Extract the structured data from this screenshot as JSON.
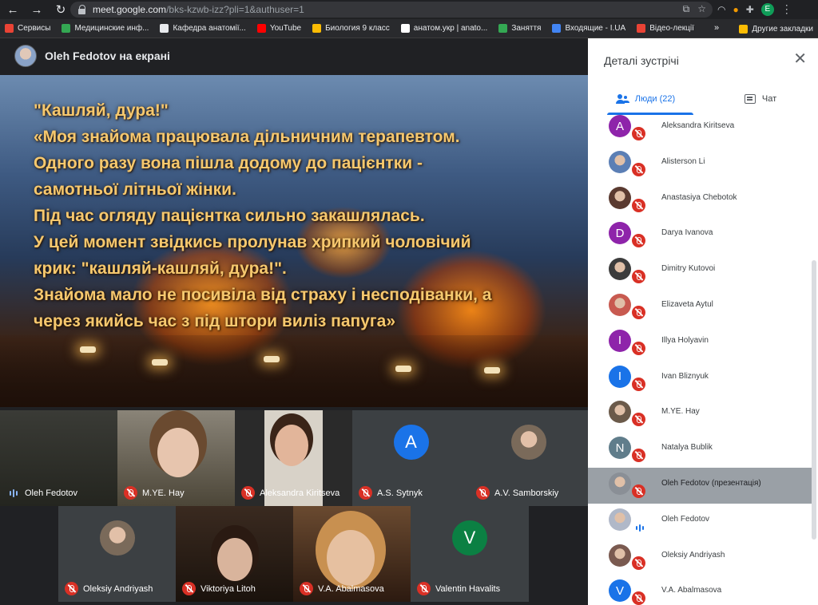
{
  "browser": {
    "url_host": "meet.google.com",
    "url_path": "/bks-kzwb-izz?pli=1&authuser=1",
    "profile_initial": "E",
    "bookmarks": [
      {
        "label": "Сервисы",
        "color": "#ea4335"
      },
      {
        "label": "Медицинские инф...",
        "color": "#34a853"
      },
      {
        "label": "Кафедра анатомії...",
        "color": "#e8eaed"
      },
      {
        "label": "YouTube",
        "color": "#ff0000"
      },
      {
        "label": "Биология 9 класс",
        "color": "#fbbc04"
      },
      {
        "label": "анатом.укр | anato...",
        "color": "#ffffff"
      },
      {
        "label": "Заняття",
        "color": "#34a853"
      },
      {
        "label": "Входящие - I.UA",
        "color": "#4285f4"
      },
      {
        "label": "Відео-лекції",
        "color": "#ea4335"
      }
    ],
    "bookmarks_more": "»",
    "other_bookmarks": "Другие закладки"
  },
  "meet": {
    "presenter_label": "Oleh Fedotov на екрані",
    "slide_lines": [
      "\"Кашляй, дура!\"",
      "«Моя знайома працювала дільничним терапевтом.",
      "Одного разу вона пішла додому до пацієнтки -",
      "самотньої літньої жінки.",
      "Під час огляду пацієнтка сильно закашлялась.",
      "У цей момент звідкись пролунав хрипкий чоловічий",
      "крик: \"кашляй-кашляй, дура!\".",
      "Знайома мало не посивіла від страху і несподіванки, а",
      "через якийсь час з під штори виліз папуга»"
    ],
    "tiles": [
      {
        "name": "Oleh Fedotov",
        "mic": "on",
        "kind": "video-dark"
      },
      {
        "name": "M.YE. Hay",
        "mic": "off",
        "kind": "video-woman1"
      },
      {
        "name": "Aleksandra Kiritseva",
        "mic": "off",
        "kind": "video-woman2"
      },
      {
        "name": "A.S. Sytnyk",
        "mic": "off",
        "kind": "letter",
        "letter": "A",
        "color": "#1a73e8"
      },
      {
        "name": "A.V. Samborskiy",
        "mic": "off",
        "kind": "photo"
      },
      {
        "name": "Oleksiy Andriyash",
        "mic": "off",
        "kind": "photo"
      },
      {
        "name": "Viktoriya Litoh",
        "mic": "off",
        "kind": "video-woman3"
      },
      {
        "name": "V.A. Abalmasova",
        "mic": "off",
        "kind": "video-woman4"
      },
      {
        "name": "Valentin Havalits",
        "mic": "off",
        "kind": "letter",
        "letter": "V",
        "color": "#0b8043"
      }
    ]
  },
  "panel": {
    "title": "Деталі зустрічі",
    "tab_people": "Люди (22)",
    "tab_chat": "Чат",
    "people": [
      {
        "name": "Aleksandra Kiritseva",
        "avatar": "letter",
        "letter": "A",
        "color": "#8e24aa",
        "mic": "off"
      },
      {
        "name": "Alisterson Li",
        "avatar": "photo",
        "color": "#5b7fb5",
        "mic": "off"
      },
      {
        "name": "Anastasiya Chebotok",
        "avatar": "photo",
        "color": "#5a3a30",
        "mic": "off"
      },
      {
        "name": "Darya Ivanova",
        "avatar": "letter",
        "letter": "D",
        "color": "#8e24aa",
        "mic": "off"
      },
      {
        "name": "Dimitry Kutovoi",
        "avatar": "photo",
        "color": "#3c3c3c",
        "mic": "off"
      },
      {
        "name": "Elizaveta Aytul",
        "avatar": "photo",
        "color": "#c85a50",
        "mic": "off"
      },
      {
        "name": "Illya Holyavin",
        "avatar": "letter",
        "letter": "I",
        "color": "#8e24aa",
        "mic": "off"
      },
      {
        "name": "Ivan Bliznyuk",
        "avatar": "letter",
        "letter": "I",
        "color": "#1a73e8",
        "mic": "off"
      },
      {
        "name": "M.YE. Hay",
        "avatar": "photo",
        "color": "#6b5a4a",
        "mic": "off"
      },
      {
        "name": "Natalya Bublik",
        "avatar": "letter",
        "letter": "N",
        "color": "#607d8b",
        "mic": "off"
      },
      {
        "name": "Oleh Fedotov (презентація)",
        "avatar": "photo",
        "color": "#8a8f96",
        "mic": "off",
        "highlight": true
      },
      {
        "name": "Oleh Fedotov",
        "avatar": "photo",
        "color": "#b0b8c8",
        "mic": "on"
      },
      {
        "name": "Oleksiy Andriyash",
        "avatar": "photo",
        "color": "#7a5a50",
        "mic": "off"
      },
      {
        "name": "V.A. Abalmasova",
        "avatar": "letter",
        "letter": "V",
        "color": "#1a73e8",
        "mic": "off"
      }
    ]
  }
}
